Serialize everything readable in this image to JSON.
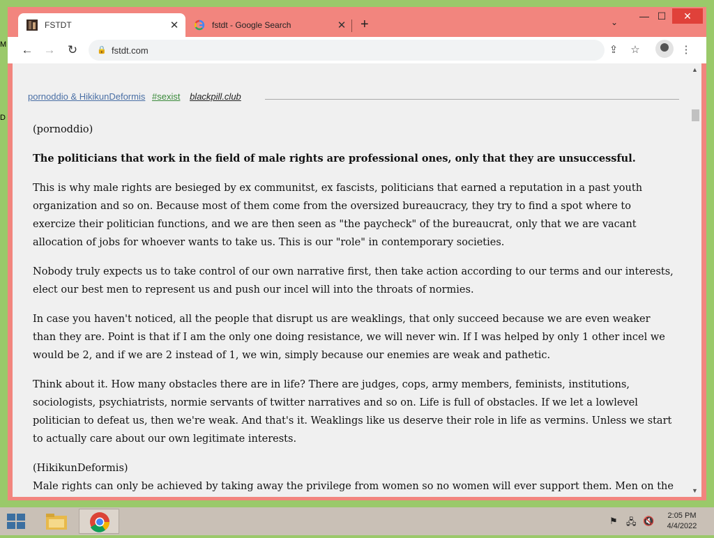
{
  "desktop": {
    "side_labels": [
      "M",
      "D"
    ]
  },
  "browser": {
    "tabs": [
      {
        "title": "FSTDT",
        "favicon": "fstdt-favicon",
        "active": true
      },
      {
        "title": "fstdt - Google Search",
        "favicon": "google-g-icon",
        "active": false
      }
    ],
    "new_tab_symbol": "+",
    "tab_search_symbol": "⌄",
    "window_controls": {
      "minimize": "—",
      "maximize": "☐",
      "close": "✕"
    },
    "nav": {
      "back": "←",
      "forward": "→",
      "reload": "↻"
    },
    "address": {
      "lock": "🔒",
      "url": "fstdt.com"
    },
    "toolbar_icons": {
      "share": "⇪",
      "bookmark": "☆",
      "menu": "⋮"
    }
  },
  "post": {
    "authors": "pornoddio & HikikunDeformis",
    "tag": "#sexist",
    "site": "blackpill.club",
    "paragraphs": [
      {
        "text": "(pornoddio)",
        "bold": false
      },
      {
        "text": "The politicians that work in the field of male rights are professional ones, only that they are unsuccessful.",
        "bold": true
      },
      {
        "text": "This is why male rights are besieged by ex communitst, ex fascists, politicians that earned a reputation in a past youth organization and so on. Because most of them come from the oversized bureaucracy, they try to find a spot where to exercize their politician functions, and we are then seen as \"the paycheck\" of the bureaucrat, only that we are vacant allocation of jobs for whoever wants to take us. This is our \"role\" in contemporary societies.",
        "bold": false
      },
      {
        "text": "Nobody truly expects us to take control of our own narrative first, then take action according to our terms and our interests, elect our best men to represent us and push our incel will into the throats of normies.",
        "bold": false
      },
      {
        "text": "In case you haven't noticed, all the people that disrupt us are weaklings, that only succeed because we are even weaker than they are. Point is that if I am the only one doing resistance, we will never win. If I was helped by only 1 other incel we would be 2, and if we are 2 instead of 1, we win, simply because our enemies are weak and pathetic.",
        "bold": false
      },
      {
        "text": "Think about it. How many obstacles there are in life? There are judges, cops, army members, feminists, institutions, sociologists, psychiatrists, normie servants of twitter narratives and so on. Life is full of obstacles. If we let a lowlevel politician to defeat us, then we're weak. And that's it. Weaklings like us deserve their role in life as vermins. Unless we start to actually care about our own legitimate interests.",
        "bold": false
      }
    ],
    "second_author_label": "(HikikunDeformis)",
    "second_text": "Male rights can only be achieved by taking away the privilege from women so no women will ever support them. Men on the other hand are either brainwashed into thinking that they're doing better or never think that it's a place for them to suffer, just because they"
  },
  "taskbar": {
    "apps": [
      {
        "name": "file-explorer",
        "active": false
      },
      {
        "name": "chrome",
        "active": true
      }
    ],
    "tray": {
      "flag": "⚑",
      "network": "🖧",
      "volume": "🔇"
    },
    "time": "2:05 PM",
    "date": "4/4/2022"
  }
}
